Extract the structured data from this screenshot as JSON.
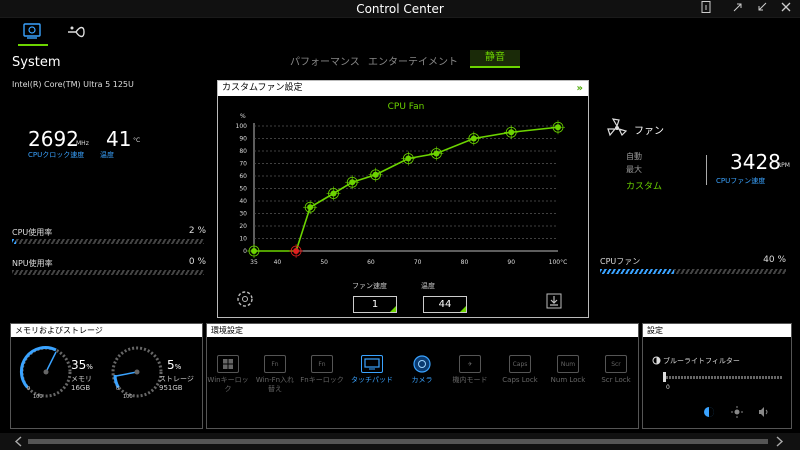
{
  "window": {
    "title": "Control Center"
  },
  "system": {
    "title": "System",
    "cpu_model": "Intel(R) Core(TM) Ultra 5 125U",
    "cpu_clock": {
      "value": "2692",
      "unit": "MHz",
      "label": "CPUクロック速度"
    },
    "temperature": {
      "value": "41",
      "unit": "°C",
      "label": "温度"
    },
    "cpu_usage": {
      "label": "CPU使用率",
      "value": "2 %",
      "percent": 2
    },
    "npu_usage": {
      "label": "NPU使用率",
      "value": "0 %",
      "percent": 0
    }
  },
  "modes": {
    "performance": "パフォーマンス",
    "entertainment": "エンターテイメント",
    "silent": "静音"
  },
  "fan_panel": {
    "title": "カスタムファン設定",
    "chart_title": "CPU Fan",
    "speed_label": "ファン速度",
    "speed_value": "1",
    "temp_label": "温度",
    "temp_value": "44"
  },
  "chart_data": {
    "type": "line",
    "title": "CPU Fan",
    "x_ticks": [
      "35",
      "40",
      "50",
      "60",
      "70",
      "80",
      "90",
      "100°C"
    ],
    "y_ticks": [
      "0",
      "10",
      "20",
      "30",
      "40",
      "50",
      "60",
      "70",
      "80",
      "90",
      "100"
    ],
    "y_unit": "%",
    "xlim": [
      35,
      100
    ],
    "ylim": [
      0,
      100
    ],
    "x": [
      35,
      44,
      47,
      52,
      56,
      61,
      68,
      74,
      82,
      90,
      100
    ],
    "y": [
      0,
      0,
      35,
      46,
      55,
      61,
      74,
      78,
      90,
      95,
      99
    ],
    "selected_index": 1,
    "grid": true
  },
  "fan": {
    "title": "ファン",
    "options": [
      "自動",
      "最大",
      "カスタム"
    ],
    "selected": "カスタム",
    "rpm_value": "3428",
    "rpm_unit": "RPM",
    "rpm_label": "CPUファン速度",
    "bar_label": "CPUファン",
    "bar_value": "40 %",
    "bar_percent": 40
  },
  "memory": {
    "title": "メモリおよびストレージ",
    "mem_percent": "35",
    "mem_label": "メモリ",
    "mem_size": "16GB",
    "storage_percent": "5",
    "storage_label": "ストレージ",
    "storage_size": "951GB",
    "gauge_min": "0",
    "gauge_max": "100"
  },
  "environment": {
    "title": "環境設定",
    "items": [
      {
        "label": "Winキーロック",
        "icon": "windows-key-icon",
        "key_text": ""
      },
      {
        "label": "Win-Fn入れ替え",
        "icon": "win-fn-swap-icon",
        "key_text": "Fn"
      },
      {
        "label": "Fnキーロック",
        "icon": "fn-lock-icon",
        "key_text": "Fn"
      },
      {
        "label": "タッチパッド",
        "icon": "touchpad-icon",
        "key_text": ""
      },
      {
        "label": "カメラ",
        "icon": "camera-icon",
        "key_text": ""
      },
      {
        "label": "機内モード",
        "icon": "airplane-icon",
        "key_text": "✈"
      },
      {
        "label": "Caps Lock",
        "icon": "caps-lock-icon",
        "key_text": "Caps"
      },
      {
        "label": "Num Lock",
        "icon": "num-lock-icon",
        "key_text": "Num"
      },
      {
        "label": "Scr Lock",
        "icon": "scroll-lock-icon",
        "key_text": "Scr"
      }
    ]
  },
  "settings": {
    "title": "設定",
    "blue_light_label": "ブルーライトフィルター",
    "blue_light_value": "0"
  },
  "colors": {
    "accent_green": "#6cd400",
    "accent_blue": "#3aa3ff",
    "point_red": "#e02020"
  }
}
